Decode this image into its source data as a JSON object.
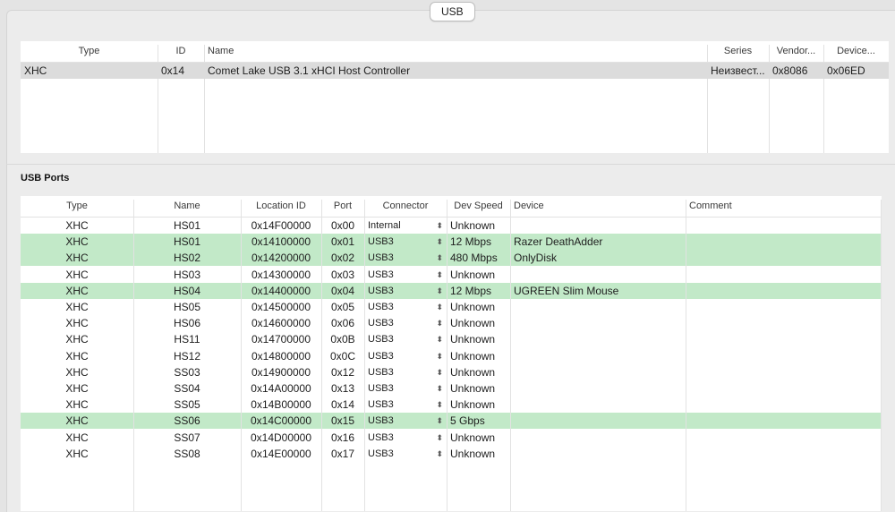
{
  "tab_label": "USB",
  "controllers": {
    "columns": [
      "Type",
      "ID",
      "Name",
      "Series",
      "Vendor...",
      "Device..."
    ],
    "rows": [
      {
        "type": "XHC",
        "id": "0x14",
        "name": "Comet Lake USB 3.1 xHCI Host Controller",
        "series": "Неизвест...",
        "vendor": "0x8086",
        "device": "0x06ED",
        "selected": true
      }
    ]
  },
  "ports_section_title": "USB Ports",
  "ports": {
    "columns": [
      "Type",
      "Name",
      "Location ID",
      "Port",
      "Connector",
      "Dev Speed",
      "Device",
      "Comment"
    ],
    "rows": [
      {
        "type": "XHC",
        "name": "HS01",
        "location": "0x14F00000",
        "port": "0x00",
        "connector": "Internal",
        "speed": "Unknown",
        "device": "",
        "comment": "",
        "active": false
      },
      {
        "type": "XHC",
        "name": "HS01",
        "location": "0x14100000",
        "port": "0x01",
        "connector": "USB3",
        "speed": "12 Mbps",
        "device": "Razer DeathAdder",
        "comment": "",
        "active": true
      },
      {
        "type": "XHC",
        "name": "HS02",
        "location": "0x14200000",
        "port": "0x02",
        "connector": "USB3",
        "speed": "480 Mbps",
        "device": "OnlyDisk",
        "comment": "",
        "active": true
      },
      {
        "type": "XHC",
        "name": "HS03",
        "location": "0x14300000",
        "port": "0x03",
        "connector": "USB3",
        "speed": "Unknown",
        "device": "",
        "comment": "",
        "active": false
      },
      {
        "type": "XHC",
        "name": "HS04",
        "location": "0x14400000",
        "port": "0x04",
        "connector": "USB3",
        "speed": "12 Mbps",
        "device": "UGREEN Slim Mouse",
        "comment": "",
        "active": true
      },
      {
        "type": "XHC",
        "name": "HS05",
        "location": "0x14500000",
        "port": "0x05",
        "connector": "USB3",
        "speed": "Unknown",
        "device": "",
        "comment": "",
        "active": false
      },
      {
        "type": "XHC",
        "name": "HS06",
        "location": "0x14600000",
        "port": "0x06",
        "connector": "USB3",
        "speed": "Unknown",
        "device": "",
        "comment": "",
        "active": false
      },
      {
        "type": "XHC",
        "name": "HS11",
        "location": "0x14700000",
        "port": "0x0B",
        "connector": "USB3",
        "speed": "Unknown",
        "device": "",
        "comment": "",
        "active": false
      },
      {
        "type": "XHC",
        "name": "HS12",
        "location": "0x14800000",
        "port": "0x0C",
        "connector": "USB3",
        "speed": "Unknown",
        "device": "",
        "comment": "",
        "active": false
      },
      {
        "type": "XHC",
        "name": "SS03",
        "location": "0x14900000",
        "port": "0x12",
        "connector": "USB3",
        "speed": "Unknown",
        "device": "",
        "comment": "",
        "active": false
      },
      {
        "type": "XHC",
        "name": "SS04",
        "location": "0x14A00000",
        "port": "0x13",
        "connector": "USB3",
        "speed": "Unknown",
        "device": "",
        "comment": "",
        "active": false
      },
      {
        "type": "XHC",
        "name": "SS05",
        "location": "0x14B00000",
        "port": "0x14",
        "connector": "USB3",
        "speed": "Unknown",
        "device": "",
        "comment": "",
        "active": false
      },
      {
        "type": "XHC",
        "name": "SS06",
        "location": "0x14C00000",
        "port": "0x15",
        "connector": "USB3",
        "speed": "5 Gbps",
        "device": "",
        "comment": "",
        "active": true
      },
      {
        "type": "XHC",
        "name": "SS07",
        "location": "0x14D00000",
        "port": "0x16",
        "connector": "USB3",
        "speed": "Unknown",
        "device": "",
        "comment": "",
        "active": false
      },
      {
        "type": "XHC",
        "name": "SS08",
        "location": "0x14E00000",
        "port": "0x17",
        "connector": "USB3",
        "speed": "Unknown",
        "device": "",
        "comment": "",
        "active": false
      }
    ]
  },
  "colors": {
    "active_row": "#c2e9c8",
    "selected_row": "#dcdcdc"
  }
}
